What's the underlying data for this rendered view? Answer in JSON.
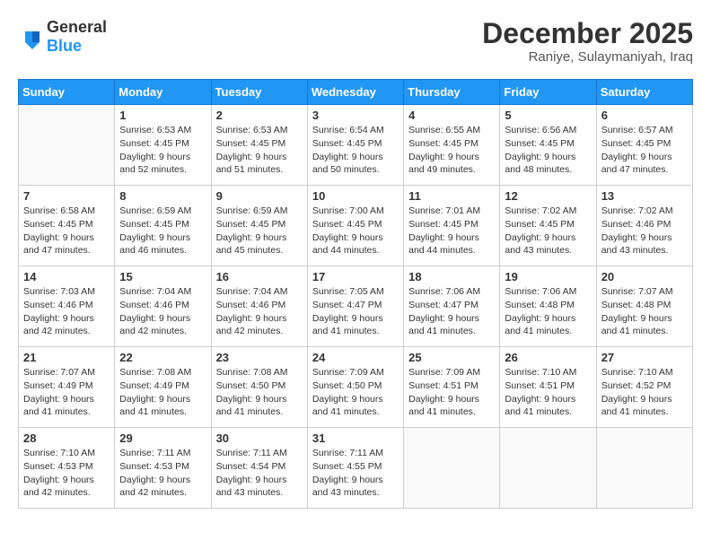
{
  "header": {
    "logo": {
      "general": "General",
      "blue": "Blue"
    },
    "title": "December 2025",
    "location": "Raniye, Sulaymaniyah, Iraq"
  },
  "days_of_week": [
    "Sunday",
    "Monday",
    "Tuesday",
    "Wednesday",
    "Thursday",
    "Friday",
    "Saturday"
  ],
  "weeks": [
    [
      {
        "day": "",
        "data": []
      },
      {
        "day": "1",
        "data": [
          "Sunrise: 6:53 AM",
          "Sunset: 4:45 PM",
          "Daylight: 9 hours",
          "and 52 minutes."
        ]
      },
      {
        "day": "2",
        "data": [
          "Sunrise: 6:53 AM",
          "Sunset: 4:45 PM",
          "Daylight: 9 hours",
          "and 51 minutes."
        ]
      },
      {
        "day": "3",
        "data": [
          "Sunrise: 6:54 AM",
          "Sunset: 4:45 PM",
          "Daylight: 9 hours",
          "and 50 minutes."
        ]
      },
      {
        "day": "4",
        "data": [
          "Sunrise: 6:55 AM",
          "Sunset: 4:45 PM",
          "Daylight: 9 hours",
          "and 49 minutes."
        ]
      },
      {
        "day": "5",
        "data": [
          "Sunrise: 6:56 AM",
          "Sunset: 4:45 PM",
          "Daylight: 9 hours",
          "and 48 minutes."
        ]
      },
      {
        "day": "6",
        "data": [
          "Sunrise: 6:57 AM",
          "Sunset: 4:45 PM",
          "Daylight: 9 hours",
          "and 47 minutes."
        ]
      }
    ],
    [
      {
        "day": "7",
        "data": [
          "Sunrise: 6:58 AM",
          "Sunset: 4:45 PM",
          "Daylight: 9 hours",
          "and 47 minutes."
        ]
      },
      {
        "day": "8",
        "data": [
          "Sunrise: 6:59 AM",
          "Sunset: 4:45 PM",
          "Daylight: 9 hours",
          "and 46 minutes."
        ]
      },
      {
        "day": "9",
        "data": [
          "Sunrise: 6:59 AM",
          "Sunset: 4:45 PM",
          "Daylight: 9 hours",
          "and 45 minutes."
        ]
      },
      {
        "day": "10",
        "data": [
          "Sunrise: 7:00 AM",
          "Sunset: 4:45 PM",
          "Daylight: 9 hours",
          "and 44 minutes."
        ]
      },
      {
        "day": "11",
        "data": [
          "Sunrise: 7:01 AM",
          "Sunset: 4:45 PM",
          "Daylight: 9 hours",
          "and 44 minutes."
        ]
      },
      {
        "day": "12",
        "data": [
          "Sunrise: 7:02 AM",
          "Sunset: 4:45 PM",
          "Daylight: 9 hours",
          "and 43 minutes."
        ]
      },
      {
        "day": "13",
        "data": [
          "Sunrise: 7:02 AM",
          "Sunset: 4:46 PM",
          "Daylight: 9 hours",
          "and 43 minutes."
        ]
      }
    ],
    [
      {
        "day": "14",
        "data": [
          "Sunrise: 7:03 AM",
          "Sunset: 4:46 PM",
          "Daylight: 9 hours",
          "and 42 minutes."
        ]
      },
      {
        "day": "15",
        "data": [
          "Sunrise: 7:04 AM",
          "Sunset: 4:46 PM",
          "Daylight: 9 hours",
          "and 42 minutes."
        ]
      },
      {
        "day": "16",
        "data": [
          "Sunrise: 7:04 AM",
          "Sunset: 4:46 PM",
          "Daylight: 9 hours",
          "and 42 minutes."
        ]
      },
      {
        "day": "17",
        "data": [
          "Sunrise: 7:05 AM",
          "Sunset: 4:47 PM",
          "Daylight: 9 hours",
          "and 41 minutes."
        ]
      },
      {
        "day": "18",
        "data": [
          "Sunrise: 7:06 AM",
          "Sunset: 4:47 PM",
          "Daylight: 9 hours",
          "and 41 minutes."
        ]
      },
      {
        "day": "19",
        "data": [
          "Sunrise: 7:06 AM",
          "Sunset: 4:48 PM",
          "Daylight: 9 hours",
          "and 41 minutes."
        ]
      },
      {
        "day": "20",
        "data": [
          "Sunrise: 7:07 AM",
          "Sunset: 4:48 PM",
          "Daylight: 9 hours",
          "and 41 minutes."
        ]
      }
    ],
    [
      {
        "day": "21",
        "data": [
          "Sunrise: 7:07 AM",
          "Sunset: 4:49 PM",
          "Daylight: 9 hours",
          "and 41 minutes."
        ]
      },
      {
        "day": "22",
        "data": [
          "Sunrise: 7:08 AM",
          "Sunset: 4:49 PM",
          "Daylight: 9 hours",
          "and 41 minutes."
        ]
      },
      {
        "day": "23",
        "data": [
          "Sunrise: 7:08 AM",
          "Sunset: 4:50 PM",
          "Daylight: 9 hours",
          "and 41 minutes."
        ]
      },
      {
        "day": "24",
        "data": [
          "Sunrise: 7:09 AM",
          "Sunset: 4:50 PM",
          "Daylight: 9 hours",
          "and 41 minutes."
        ]
      },
      {
        "day": "25",
        "data": [
          "Sunrise: 7:09 AM",
          "Sunset: 4:51 PM",
          "Daylight: 9 hours",
          "and 41 minutes."
        ]
      },
      {
        "day": "26",
        "data": [
          "Sunrise: 7:10 AM",
          "Sunset: 4:51 PM",
          "Daylight: 9 hours",
          "and 41 minutes."
        ]
      },
      {
        "day": "27",
        "data": [
          "Sunrise: 7:10 AM",
          "Sunset: 4:52 PM",
          "Daylight: 9 hours",
          "and 41 minutes."
        ]
      }
    ],
    [
      {
        "day": "28",
        "data": [
          "Sunrise: 7:10 AM",
          "Sunset: 4:53 PM",
          "Daylight: 9 hours",
          "and 42 minutes."
        ]
      },
      {
        "day": "29",
        "data": [
          "Sunrise: 7:11 AM",
          "Sunset: 4:53 PM",
          "Daylight: 9 hours",
          "and 42 minutes."
        ]
      },
      {
        "day": "30",
        "data": [
          "Sunrise: 7:11 AM",
          "Sunset: 4:54 PM",
          "Daylight: 9 hours",
          "and 43 minutes."
        ]
      },
      {
        "day": "31",
        "data": [
          "Sunrise: 7:11 AM",
          "Sunset: 4:55 PM",
          "Daylight: 9 hours",
          "and 43 minutes."
        ]
      },
      {
        "day": "",
        "data": []
      },
      {
        "day": "",
        "data": []
      },
      {
        "day": "",
        "data": []
      }
    ]
  ]
}
